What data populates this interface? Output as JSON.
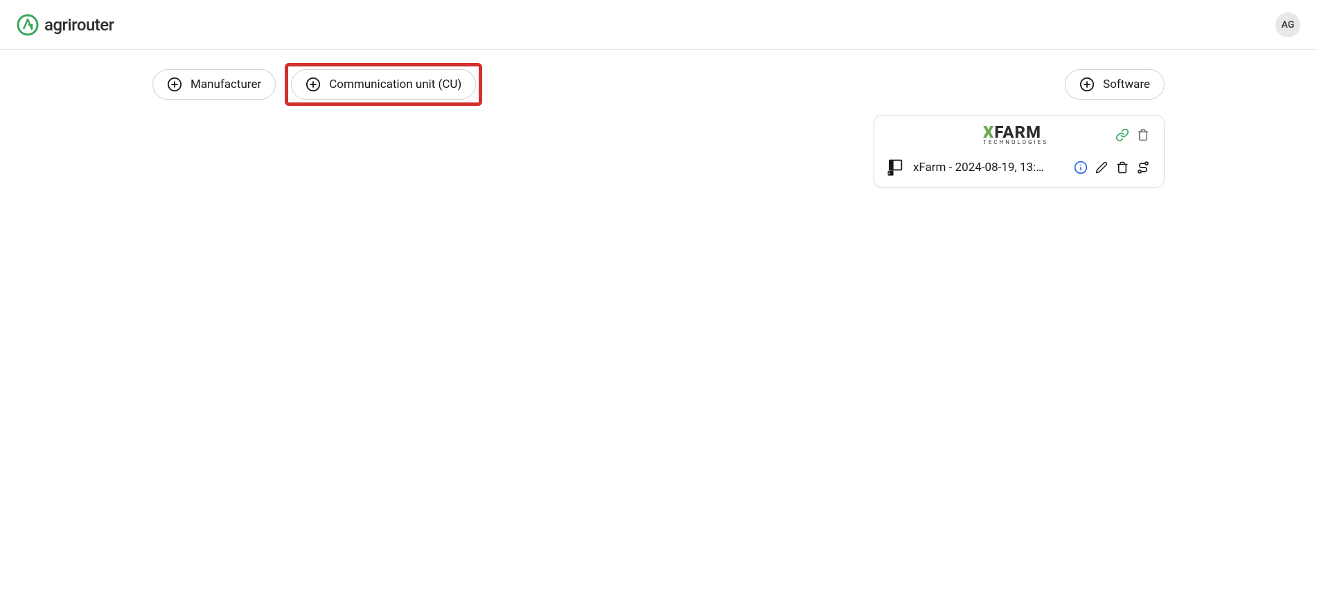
{
  "header": {
    "logo_text": "agrirouter",
    "avatar_initials": "AG"
  },
  "buttons": {
    "manufacturer": "Manufacturer",
    "communication_unit": "Communication unit (CU)",
    "software": "Software"
  },
  "card": {
    "brand_name": "FARM",
    "brand_prefix": "X",
    "brand_subtitle": "TECHNOLOGIES",
    "entry_label": "xFarm - 2024-08-19, 13:…"
  },
  "colors": {
    "accent_green": "#3ba55c",
    "highlight_red": "#d32f2f",
    "info_blue": "#2563eb",
    "brand_green": "#6aa84f"
  }
}
